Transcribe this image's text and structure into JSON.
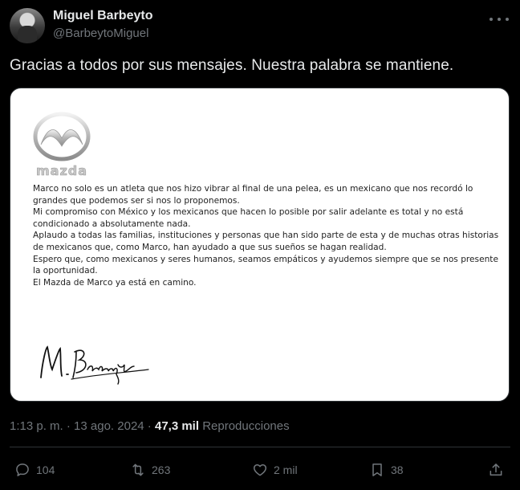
{
  "author": {
    "name": "Miguel Barbeyto",
    "handle": "@BarbeytoMiguel"
  },
  "tweet": {
    "text": "Gracias a todos por sus mensajes. Nuestra palabra se mantiene."
  },
  "media": {
    "logo_text": "mazda",
    "letter": {
      "p1": "Marco no solo es un atleta que nos hizo vibrar al final de una pelea, es un mexicano que nos recordó lo grandes que podemos ser si nos lo proponemos.",
      "p2": "Mi compromiso con México y los mexicanos que hacen lo posible por salir adelante es total y no está condicionado a absolutamente nada.",
      "p3": "Aplaudo a todas las familias, instituciones y personas que han sido parte de esta y de muchas otras historias de mexicanos que, como Marco, han ayudado a que sus sueños se hagan realidad.",
      "p4": "Espero que, como mexicanos y seres humanos, seamos empáticos y ayudemos siempre que se nos presente la oportunidad.",
      "p5": "El Mazda de Marco ya está en camino."
    },
    "signature": "M. Barbeyto"
  },
  "meta": {
    "time": "1:13 p. m.",
    "separator": " · ",
    "date": "13 ago. 2024",
    "separator2": " · ",
    "views_count": "47,3 mil",
    "views_label": " Reproducciones"
  },
  "actions": {
    "replies": "104",
    "retweets": "263",
    "likes": "2 mil",
    "bookmarks": "38"
  },
  "icons": {
    "reply": "reply-icon",
    "retweet": "retweet-icon",
    "like": "heart-icon",
    "bookmark": "bookmark-icon",
    "share": "share-icon",
    "more": "more-icon"
  }
}
